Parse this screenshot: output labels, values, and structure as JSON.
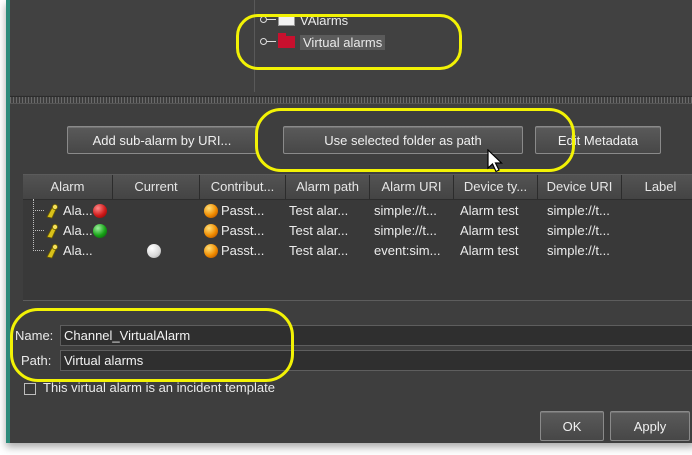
{
  "tree": {
    "items": [
      {
        "label": "VAlarms",
        "folder": "white"
      },
      {
        "label": "Virtual alarms",
        "folder": "red",
        "selected": true
      }
    ]
  },
  "toolbar": {
    "add_sub_alarm_label": "Add sub-alarm by URI...",
    "use_folder_label": "Use selected folder as path",
    "edit_metadata_label": "Edit Metadata"
  },
  "table": {
    "columns": [
      "Alarm",
      "Current",
      "Contribut...",
      "Alarm path",
      "Alarm URI",
      "Device ty...",
      "Device URI",
      "Label"
    ],
    "rows": [
      {
        "alarm": "Ala...",
        "current": "red",
        "contrib": "Passt...",
        "path": "Test alar...",
        "uri": "simple://t...",
        "device_type": "Alarm test",
        "device_uri": "simple://t..."
      },
      {
        "alarm": "Ala...",
        "current": "green",
        "contrib": "Passt...",
        "path": "Test alar...",
        "uri": "simple://t...",
        "device_type": "Alarm test",
        "device_uri": "simple://t..."
      },
      {
        "alarm": "Ala...",
        "current": "white",
        "contrib": "Passt...",
        "path": "Test alar...",
        "uri": "event:sim...",
        "device_type": "Alarm test",
        "device_uri": "simple://t..."
      }
    ]
  },
  "form": {
    "name_label": "Name:",
    "name_value": "Channel_VirtualAlarm",
    "path_label": "Path:",
    "path_value": "Virtual alarms",
    "incident_label": "This virtual alarm is an incident template"
  },
  "footer": {
    "ok_label": "OK",
    "apply_label": "Apply"
  },
  "colors": {
    "highlight": "#f2f205",
    "background": "#3e3e3e"
  }
}
